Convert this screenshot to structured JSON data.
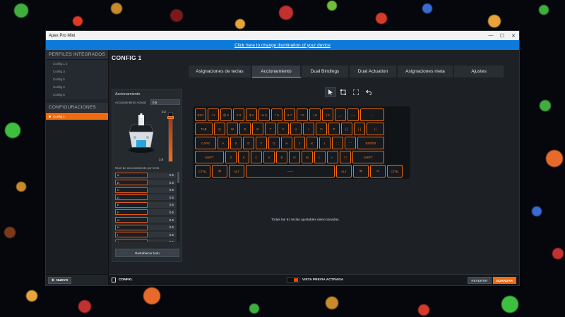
{
  "window": {
    "title": "Apex Pro Mini",
    "controls": [
      "—",
      "☐",
      "✕"
    ]
  },
  "banner": {
    "link_text": "Click here to change illumination of your device"
  },
  "sidebar": {
    "integrated_header": "PERFILES INTEGRADOS",
    "integrated_items": [
      "Config 1 2",
      "Config 3",
      "Config 5",
      "Config 4",
      "Config 6"
    ],
    "configs_header": "CONFIGURACIONES",
    "config_items": [
      "Config 1"
    ],
    "new_button": "NUEVO"
  },
  "main": {
    "config_title": "CONFIG 1",
    "tabs": [
      {
        "label": "Asignaciones de teclas",
        "active": false
      },
      {
        "label": "Accionamiento",
        "active": true
      },
      {
        "label": "Dual Bindings",
        "active": false
      },
      {
        "label": "Dual Actuation",
        "active": false
      },
      {
        "label": "Asignaciones meta",
        "active": false
      },
      {
        "label": "Ajustes",
        "active": false
      }
    ],
    "status_message": "Todas las 61 teclas ajustables seleccionadas."
  },
  "actuation_panel": {
    "title": "Accionamiento",
    "actual_label": "Accionamiento Actual:",
    "actual_value": "0.5",
    "scale_top": "0.2",
    "scale_bottom": "3.8",
    "slider_level_fraction": 0.92,
    "levels_label": "Nivel de accionamiento por tecla",
    "levels": [
      {
        "key": "A",
        "value": "0.5"
      },
      {
        "key": "B",
        "value": "0.5"
      },
      {
        "key": "C",
        "value": "0.5"
      },
      {
        "key": "D",
        "value": "0.5"
      },
      {
        "key": "E",
        "value": "0.5"
      },
      {
        "key": "F",
        "value": "0.5"
      },
      {
        "key": "G",
        "value": "0.5"
      },
      {
        "key": "H",
        "value": "0.5"
      },
      {
        "key": "I",
        "value": "0.5"
      },
      {
        "key": "J",
        "value": "0.5"
      }
    ],
    "reset_button": "Restablecer todo"
  },
  "tools": [
    "pointer-icon",
    "select-box-icon",
    "fullscreen-icon",
    "undo-icon"
  ],
  "keyboard": {
    "accent": "#f06a10",
    "rows": [
      [
        {
          "l": "ESC",
          "w": 16
        },
        {
          "l": "! 1",
          "w": 16
        },
        {
          "l": "@ 2",
          "w": 16
        },
        {
          "l": "# 3",
          "w": 16
        },
        {
          "l": "$ 4",
          "w": 16
        },
        {
          "l": "% 5",
          "w": 16
        },
        {
          "l": "^ 6",
          "w": 16
        },
        {
          "l": "& 7",
          "w": 16
        },
        {
          "l": "* 8",
          "w": 16
        },
        {
          "l": "( 9",
          "w": 16
        },
        {
          "l": ") 0",
          "w": 16
        },
        {
          "l": "_ -",
          "w": 16
        },
        {
          "l": "+ =",
          "w": 16
        },
        {
          "l": "←",
          "w": 34
        }
      ],
      [
        {
          "l": "TAB",
          "w": 25
        },
        {
          "l": "Q",
          "w": 16
        },
        {
          "l": "W",
          "w": 16
        },
        {
          "l": "E",
          "w": 16
        },
        {
          "l": "R",
          "w": 16
        },
        {
          "l": "T",
          "w": 16
        },
        {
          "l": "Y",
          "w": 16
        },
        {
          "l": "U",
          "w": 16
        },
        {
          "l": "I",
          "w": 16
        },
        {
          "l": "O",
          "w": 16
        },
        {
          "l": "P",
          "w": 16
        },
        {
          "l": "{ [",
          "w": 16
        },
        {
          "l": "} ]",
          "w": 16
        },
        {
          "l": "| \\",
          "w": 25
        }
      ],
      [
        {
          "l": "CAPS",
          "w": 30
        },
        {
          "l": "A",
          "w": 16
        },
        {
          "l": "S",
          "w": 16
        },
        {
          "l": "D",
          "w": 16
        },
        {
          "l": "F",
          "w": 16
        },
        {
          "l": "G",
          "w": 16
        },
        {
          "l": "H",
          "w": 16
        },
        {
          "l": "J",
          "w": 16
        },
        {
          "l": "K",
          "w": 16
        },
        {
          "l": "L",
          "w": 16
        },
        {
          "l": ": ;",
          "w": 16
        },
        {
          "l": "\" '",
          "w": 16
        },
        {
          "l": "ENTER",
          "w": 38
        }
      ],
      [
        {
          "l": "SHIFT",
          "w": 41
        },
        {
          "l": "Z",
          "w": 16
        },
        {
          "l": "X",
          "w": 16
        },
        {
          "l": "C",
          "w": 16
        },
        {
          "l": "V",
          "w": 16
        },
        {
          "l": "B",
          "w": 16
        },
        {
          "l": "N",
          "w": 16
        },
        {
          "l": "M",
          "w": 16
        },
        {
          "l": "< ,",
          "w": 16
        },
        {
          "l": "> .",
          "w": 16
        },
        {
          "l": "? /",
          "w": 16
        },
        {
          "l": "SHIFT",
          "w": 45
        }
      ],
      [
        {
          "l": "CTRL",
          "w": 22
        },
        {
          "l": "⊞",
          "w": 22
        },
        {
          "l": "ALT",
          "w": 22
        },
        {
          "l": "——",
          "w": 126
        },
        {
          "l": "ALT",
          "w": 22
        },
        {
          "l": "⊞",
          "w": 22
        },
        {
          "l": "⊙",
          "w": 22
        },
        {
          "l": "CTRL",
          "w": 22
        }
      ]
    ]
  },
  "bottom": {
    "config_button": "CONFIG.",
    "preview_label": "VISTA PREVIA ACTIVADA",
    "revert_button": "REVERTIR",
    "save_button": "GUARDAR"
  }
}
